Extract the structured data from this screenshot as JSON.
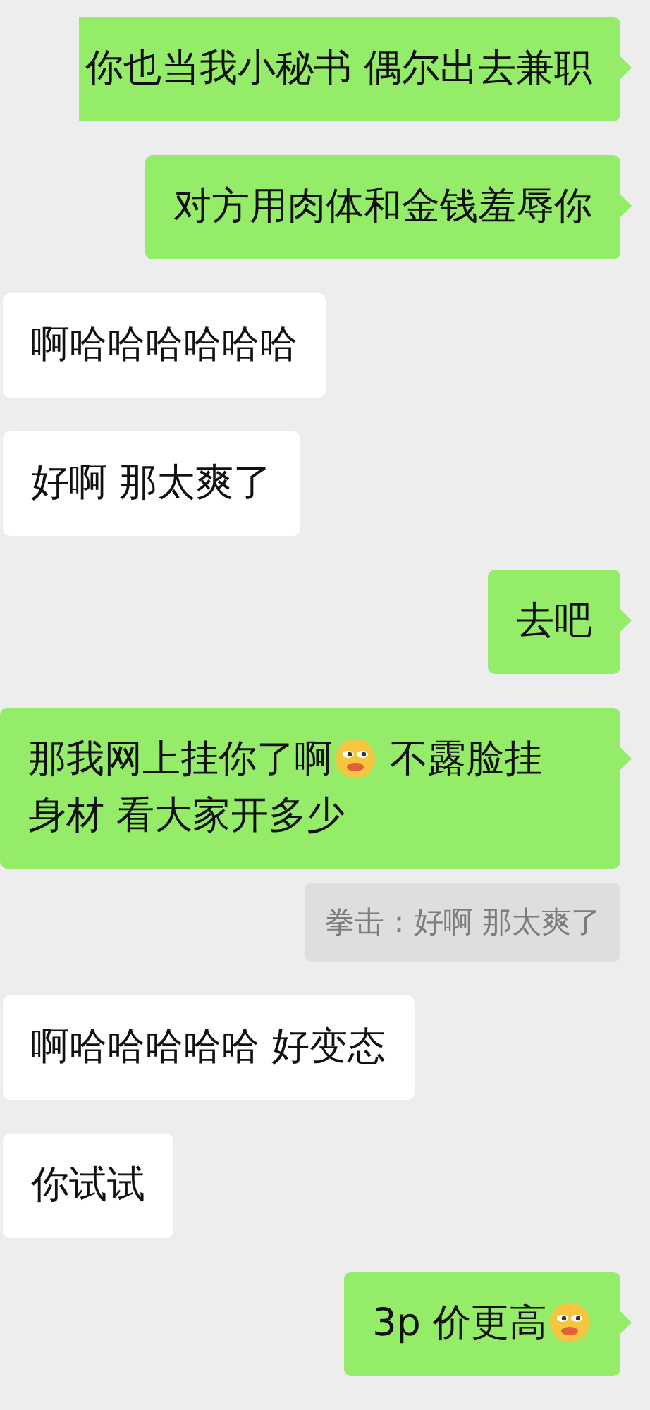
{
  "messages": [
    {
      "outgoing": true,
      "kind": "text",
      "segments": [
        {
          "kind": "text",
          "text": "你也当我小秘书 偶尔出去兼职"
        }
      ]
    },
    {
      "outgoing": true,
      "kind": "text",
      "segments": [
        {
          "kind": "text",
          "text": "对方用肉体和金钱羞辱你"
        }
      ]
    },
    {
      "outgoing": false,
      "kind": "text",
      "segments": [
        {
          "kind": "text",
          "text": "啊哈哈哈哈哈哈"
        }
      ]
    },
    {
      "outgoing": false,
      "kind": "text",
      "segments": [
        {
          "kind": "text",
          "text": "好啊 那太爽了"
        }
      ]
    },
    {
      "outgoing": true,
      "kind": "text",
      "segments": [
        {
          "kind": "text",
          "text": "去吧"
        }
      ]
    },
    {
      "outgoing": true,
      "kind": "text",
      "segments": [
        {
          "kind": "text",
          "text": "那我网上挂你了啊"
        },
        {
          "kind": "emoji"
        },
        {
          "kind": "text",
          "text": " 不露脸挂"
        },
        {
          "kind": "text",
          "text": "身材 看大家开多少"
        }
      ]
    },
    {
      "outgoing": true,
      "kind": "quote",
      "segments": [
        {
          "kind": "text",
          "text": "拳击：好啊 那太爽了"
        }
      ]
    },
    {
      "outgoing": false,
      "kind": "text",
      "segments": [
        {
          "kind": "text",
          "text": "啊哈哈哈哈哈 好变态"
        }
      ]
    },
    {
      "outgoing": false,
      "kind": "text",
      "segments": [
        {
          "kind": "text",
          "text": "你试试"
        }
      ]
    },
    {
      "outgoing": true,
      "kind": "text",
      "segments": [
        {
          "kind": "text",
          "text": "3p 价更高"
        },
        {
          "kind": "emoji"
        }
      ]
    }
  ]
}
